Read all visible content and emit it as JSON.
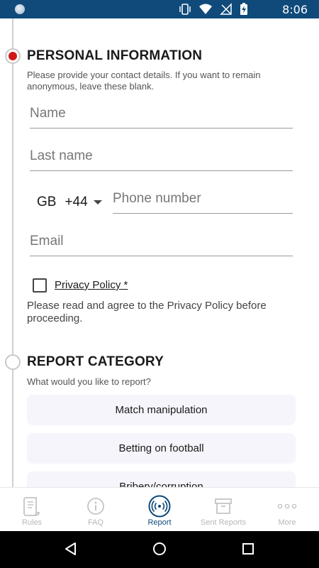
{
  "status_bar": {
    "time": "8:06"
  },
  "personal_section": {
    "title": "PERSONAL INFORMATION",
    "subtitle": "Please provide your contact details. If you want to remain anonymous, leave these blank.",
    "name_placeholder": "Name",
    "last_name_placeholder": "Last name",
    "country_code": "GB",
    "dial_code": "+44",
    "phone_placeholder": "Phone number",
    "email_placeholder": "Email",
    "privacy_label": "Privacy Policy *",
    "privacy_checked": false,
    "privacy_note": "Please read and agree to the Privacy Policy before proceeding."
  },
  "report_section": {
    "title": "REPORT CATEGORY",
    "subtitle": "What would you like to report?",
    "categories": [
      "Match manipulation",
      "Betting on football",
      "Bribery/corruption"
    ]
  },
  "bottom_nav": {
    "items": [
      {
        "label": "Rules",
        "icon": "rules-document-icon",
        "active": false
      },
      {
        "label": "FAQ",
        "icon": "info-icon",
        "active": false
      },
      {
        "label": "Report",
        "icon": "broadcast-icon",
        "active": true
      },
      {
        "label": "Sent Reports",
        "icon": "archive-box-icon",
        "active": false
      },
      {
        "label": "More",
        "icon": "more-dots-icon",
        "active": false
      }
    ]
  },
  "colors": {
    "accent": "#0f4a7a",
    "active_step": "#d01818",
    "status_bar": "#0f4a7a"
  }
}
